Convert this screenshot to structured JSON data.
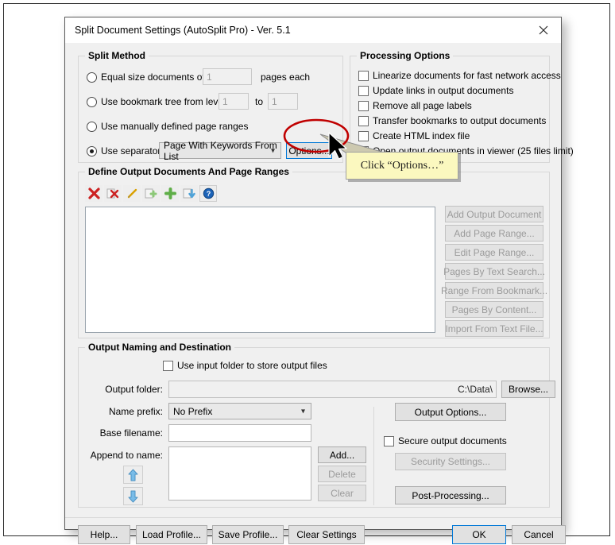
{
  "window": {
    "title": "Split Document Settings (AutoSplit Pro) - Ver. 5.1",
    "close_icon": "close-icon"
  },
  "split_method": {
    "title": "Split Method",
    "options": [
      {
        "label": "Equal size documents of",
        "selected": false,
        "suffix": "pages each",
        "value": "1"
      },
      {
        "label": "Use bookmark tree from level",
        "selected": false,
        "value_from": "1",
        "mid": "to",
        "value_to": "1"
      },
      {
        "label": "Use manually defined page ranges",
        "selected": false
      },
      {
        "label": "Use separator:",
        "selected": true,
        "combo_value": "Page With Keywords From List",
        "options_button": "Options..."
      }
    ]
  },
  "processing_options": {
    "title": "Processing Options",
    "items": [
      {
        "label": "Linearize documents for fast network access",
        "checked": false
      },
      {
        "label": "Update links in output documents",
        "checked": false
      },
      {
        "label": "Remove all page labels",
        "checked": false
      },
      {
        "label": "Transfer bookmarks to output documents",
        "checked": false
      },
      {
        "label": "Create HTML index file",
        "checked": false
      },
      {
        "label": "Open output documents in viewer (25 files limit)",
        "checked": false
      }
    ]
  },
  "define_output": {
    "title": "Define Output Documents And Page Ranges",
    "toolbar": [
      {
        "name": "delete-all-icon",
        "glyph": "✖",
        "color": "#cc2222",
        "enabled": true
      },
      {
        "name": "delete-item-icon",
        "glyph": "✖",
        "color": "#cc2222",
        "enabled": false
      },
      {
        "name": "edit-pencil-icon",
        "glyph": "╱",
        "color": "#d9a000",
        "enabled": false
      },
      {
        "name": "add-page-range-icon",
        "glyph": "✚",
        "color": "#86c06a",
        "enabled": false
      },
      {
        "name": "add-output-document-icon",
        "glyph": "✚",
        "color": "#5fae48",
        "enabled": true
      },
      {
        "name": "import-icon",
        "glyph": "⬇",
        "color": "#5aa9dd",
        "enabled": false
      },
      {
        "name": "help-icon",
        "glyph": "?",
        "color": "#1c63b8",
        "enabled": true
      }
    ],
    "list_items": [],
    "buttons": [
      {
        "label": "Add Output Document",
        "enabled": false
      },
      {
        "label": "Add Page Range...",
        "enabled": false
      },
      {
        "label": "Edit Page Range...",
        "enabled": false
      },
      {
        "label": "Pages By Text Search...",
        "enabled": false
      },
      {
        "label": "Range From Bookmark...",
        "enabled": false
      },
      {
        "label": "Pages By Content...",
        "enabled": false
      },
      {
        "label": "Import From Text File...",
        "enabled": false
      }
    ]
  },
  "output_naming": {
    "title": "Output Naming and Destination",
    "use_input_folder": {
      "label": "Use input folder to store output files",
      "checked": false
    },
    "output_folder": {
      "label": "Output folder:",
      "value": "C:\\Data\\",
      "browse": "Browse..."
    },
    "name_prefix": {
      "label": "Name prefix:",
      "value": "No Prefix"
    },
    "base_filename": {
      "label": "Base filename:",
      "value": "",
      "placeholder": ""
    },
    "append_to_name": {
      "label": "Append to name:",
      "items": [],
      "move_up_icon": "arrow-up-icon",
      "move_down_icon": "arrow-down-icon",
      "add": "Add...",
      "delete": "Delete",
      "clear": "Clear"
    },
    "output_options_button": "Output Options...",
    "secure_output": {
      "label": "Secure output documents",
      "checked": false
    },
    "security_settings_button": "Security Settings...",
    "post_processing_button": "Post-Processing..."
  },
  "footer": {
    "help": "Help...",
    "load_profile": "Load Profile...",
    "save_profile": "Save Profile...",
    "clear_settings": "Clear Settings",
    "ok": "OK",
    "cancel": "Cancel"
  },
  "annotation": {
    "callout_text": "Click “Options…”",
    "highlight_color": "#c00000",
    "callout_bg": "#fbf8bf",
    "cursor_icon": "mouse-pointer-icon"
  }
}
